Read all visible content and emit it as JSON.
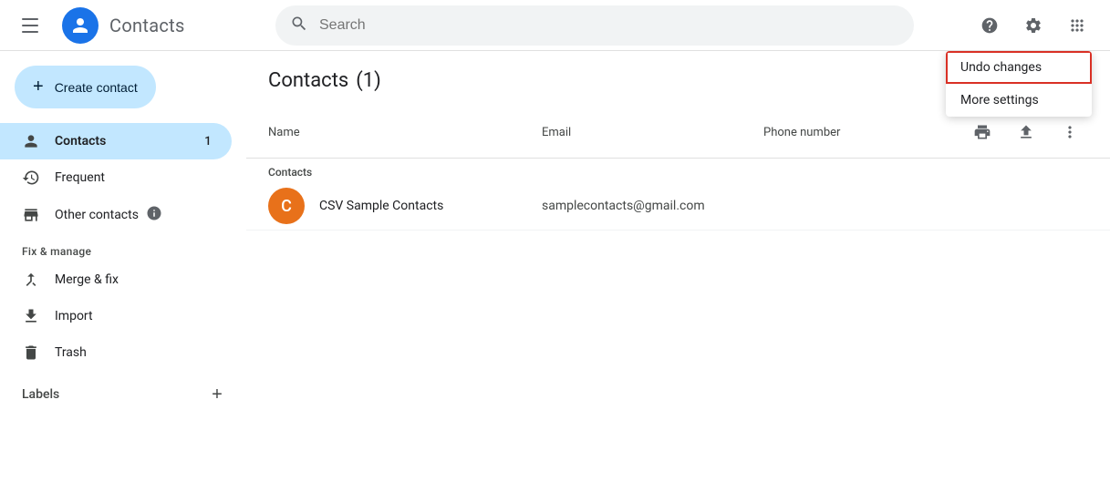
{
  "app": {
    "title": "Contacts",
    "search_placeholder": "Search"
  },
  "header": {
    "help_label": "Help",
    "settings_label": "Settings",
    "apps_label": "Google apps"
  },
  "sidebar": {
    "create_btn": "Create contact",
    "nav_items": [
      {
        "id": "contacts",
        "label": "Contacts",
        "badge": "1",
        "active": true
      },
      {
        "id": "frequent",
        "label": "Frequent",
        "badge": "",
        "active": false
      },
      {
        "id": "other-contacts",
        "label": "Other contacts",
        "badge": "",
        "active": false
      }
    ],
    "section_fix": "Fix & manage",
    "fix_items": [
      {
        "id": "merge",
        "label": "Merge & fix"
      },
      {
        "id": "import",
        "label": "Import"
      },
      {
        "id": "trash",
        "label": "Trash"
      }
    ],
    "labels_title": "Labels",
    "labels_add": "+"
  },
  "main": {
    "page_title": "Contacts",
    "count": "(1)",
    "columns": {
      "name": "Name",
      "email": "Email",
      "phone": "Phone number"
    },
    "group_label": "Contacts",
    "contacts": [
      {
        "initials": "C",
        "name": "CSV Sample Contacts",
        "email": "samplecontacts@gmail.com",
        "phone": ""
      }
    ]
  },
  "dropdown": {
    "items": [
      {
        "id": "undo-changes",
        "label": "Undo changes",
        "highlighted": true
      },
      {
        "id": "more-settings",
        "label": "More settings",
        "highlighted": false
      }
    ]
  }
}
